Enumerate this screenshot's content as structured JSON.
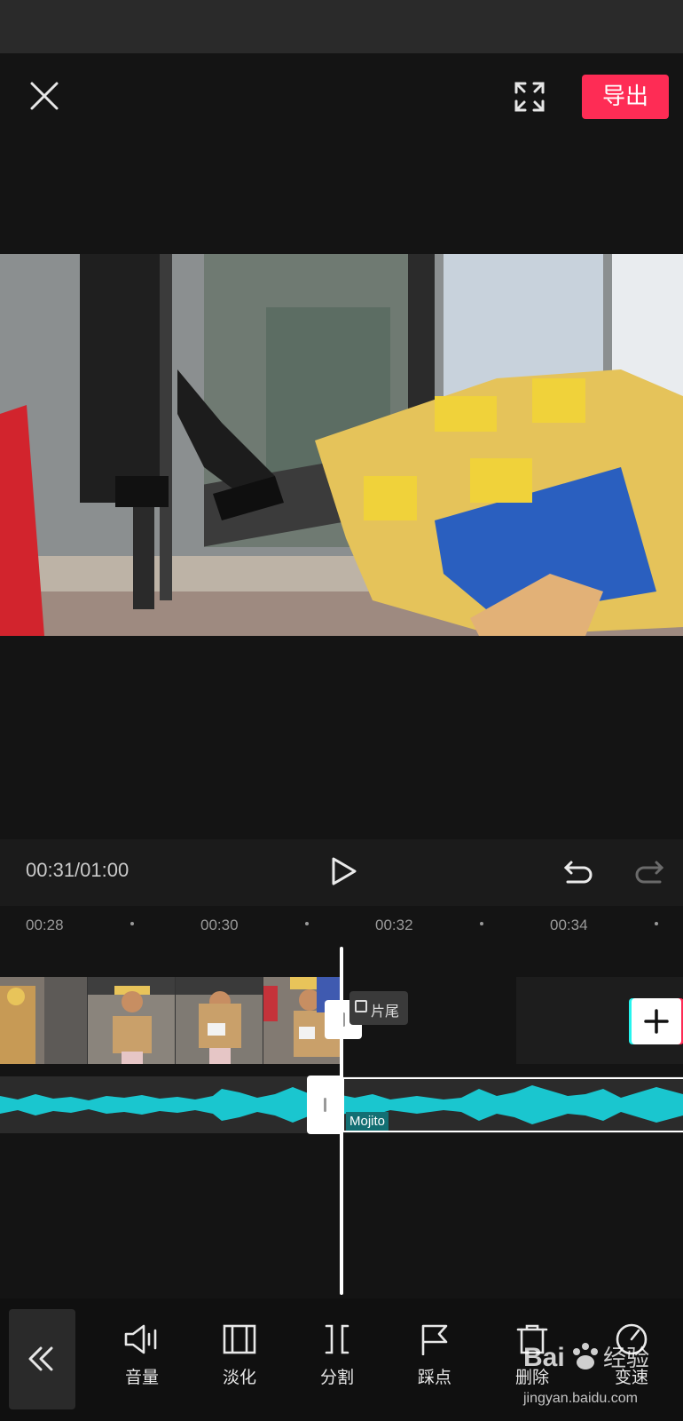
{
  "header": {
    "export_label": "导出"
  },
  "controls": {
    "timecode": "00:31/01:00"
  },
  "ruler": {
    "ticks": [
      "00:28",
      "00:30",
      "00:32",
      "00:34"
    ]
  },
  "timeline": {
    "ending_label": "片尾",
    "music_label": "Mojito"
  },
  "toolbar": {
    "items": [
      {
        "label": "音量",
        "icon": "volume-icon"
      },
      {
        "label": "淡化",
        "icon": "fade-icon"
      },
      {
        "label": "分割",
        "icon": "split-icon"
      },
      {
        "label": "踩点",
        "icon": "beat-flag-icon"
      },
      {
        "label": "删除",
        "icon": "delete-icon"
      },
      {
        "label": "变速",
        "icon": "speed-icon"
      }
    ]
  },
  "watermark": {
    "brand": "Bai 经验",
    "url": "jingyan.baidu.com"
  },
  "colors": {
    "accent": "#fe2c55",
    "waveform": "#1ac6cf",
    "cyan_edge": "#25f4ee"
  }
}
